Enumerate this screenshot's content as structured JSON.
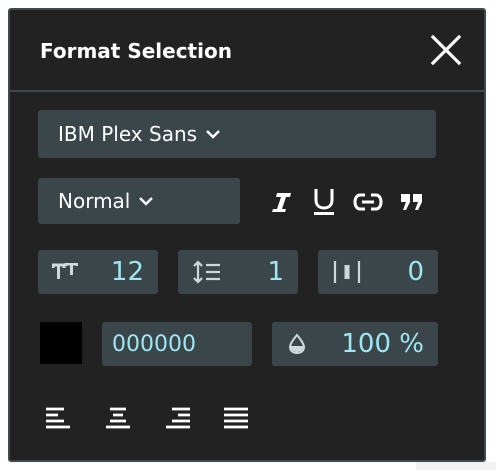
{
  "header": {
    "title": "Format Selection",
    "close_icon": "close-icon"
  },
  "font": {
    "family": "IBM Plex Sans",
    "style": "Normal"
  },
  "text_tools": [
    "italic-icon",
    "underline-icon",
    "link-icon",
    "quote-icon"
  ],
  "metrics": {
    "font_size": "12",
    "line_height": "1",
    "letter_spacing": "0"
  },
  "color": {
    "hex": "000000",
    "swatch": "#000000",
    "opacity": "100 %"
  },
  "alignment": [
    "align-left-icon",
    "align-center-icon",
    "align-right-icon",
    "align-justify-icon"
  ],
  "theme": {
    "panel_bg": "#222222",
    "field_bg": "#3a4649",
    "accent_text": "#9ee6f2"
  }
}
